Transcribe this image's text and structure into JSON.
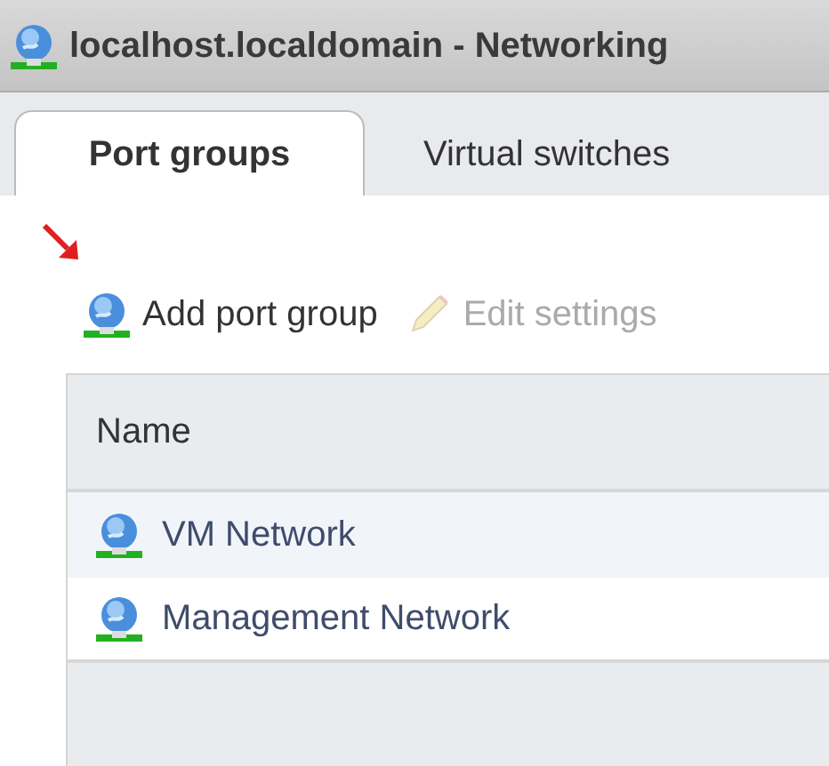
{
  "window": {
    "title": "localhost.localdomain - Networking"
  },
  "tabs": [
    {
      "label": "Port groups",
      "selected": true
    },
    {
      "label": "Virtual switches",
      "selected": false
    }
  ],
  "toolbar": [
    {
      "label": "Add port group",
      "kind": "network",
      "disabled": false,
      "pointed": true
    },
    {
      "label": "Edit settings",
      "kind": "pencil",
      "disabled": true,
      "pointed": false
    }
  ],
  "table": {
    "columns": [
      "Name"
    ],
    "rows": [
      {
        "name": "VM Network",
        "selected": true
      },
      {
        "name": "Management Network",
        "selected": false
      }
    ]
  }
}
